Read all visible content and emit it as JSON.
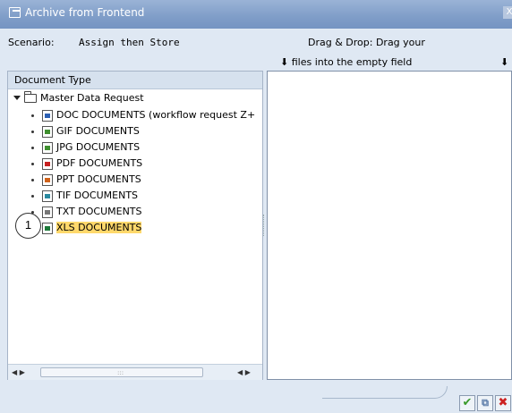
{
  "window": {
    "title": "Archive from Frontend",
    "close_glyph": "X"
  },
  "scenario": {
    "label": "Scenario:",
    "value": "Assign then Store"
  },
  "drag_drop": {
    "line1": "Drag & Drop: Drag your",
    "line2": "files into the empty field"
  },
  "tree": {
    "header": "Document Type",
    "root": "Master Data Request",
    "items": [
      {
        "label": "DOC DOCUMENTS (workflow request Z+",
        "icon": "word-doc-icon",
        "color": "#2b5fb3"
      },
      {
        "label": "GIF  DOCUMENTS",
        "icon": "image-doc-icon",
        "color": "#3f8f2f"
      },
      {
        "label": "JPG DOCUMENTS",
        "icon": "image-doc-icon",
        "color": "#3f8f2f"
      },
      {
        "label": "PDF  DOCUMENTS",
        "icon": "pdf-doc-icon",
        "color": "#c62020"
      },
      {
        "label": "PPT  DOCUMENTS",
        "icon": "ppt-doc-icon",
        "color": "#d0621a"
      },
      {
        "label": "TIF   DOCUMENTS",
        "icon": "tif-doc-icon",
        "color": "#2a8aa0"
      },
      {
        "label": "TXT  DOCUMENTS",
        "icon": "txt-doc-icon",
        "color": "#777777"
      },
      {
        "label": "XLS  DOCUMENTS",
        "icon": "excel-doc-icon",
        "color": "#1d7a3a",
        "selected": true
      }
    ]
  },
  "callout": "1",
  "buttons": {
    "ok": "✔",
    "copy": "⧉",
    "cancel": "✖"
  },
  "scroll": {
    "left": "◀ ▶",
    "right": "◀ ▶",
    "grip": ":::"
  },
  "arrow_glyph": "🡇"
}
